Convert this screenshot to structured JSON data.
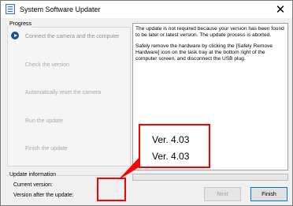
{
  "window": {
    "title": "System Software Updater",
    "close_glyph": "✕",
    "icon": "app-document-icon"
  },
  "progress_group": {
    "label": "Progress",
    "steps": [
      {
        "label": "Connect the camera and the computer",
        "state": "current"
      },
      {
        "label": "Check the version",
        "state": "pending"
      },
      {
        "label": "Automatically reset the camera",
        "state": "pending"
      },
      {
        "label": "Run the update",
        "state": "pending"
      },
      {
        "label": "Finish the update",
        "state": "pending"
      }
    ],
    "current_icon": "play-arrow-icon"
  },
  "message": {
    "paragraph1": "The update is not required because your version has been found to be later or latest version. The update process is aborted.",
    "paragraph2": "Safely remove the hardware by clicking the [Safely Remove Hardware] icon on the task tray at the bottom right of the computer screen, and disconnect the USB plug."
  },
  "progress_bar": {
    "value": 0
  },
  "update_info": {
    "label": "Update information",
    "current_version_label": "Current version:",
    "after_update_label": "Version after the update:"
  },
  "buttons": {
    "next_label": "Next",
    "finish_label": "Finish"
  },
  "callout": {
    "current_version": "Ver. 4.03",
    "version_after_update": "Ver. 4.03",
    "color": "#ff0000"
  }
}
